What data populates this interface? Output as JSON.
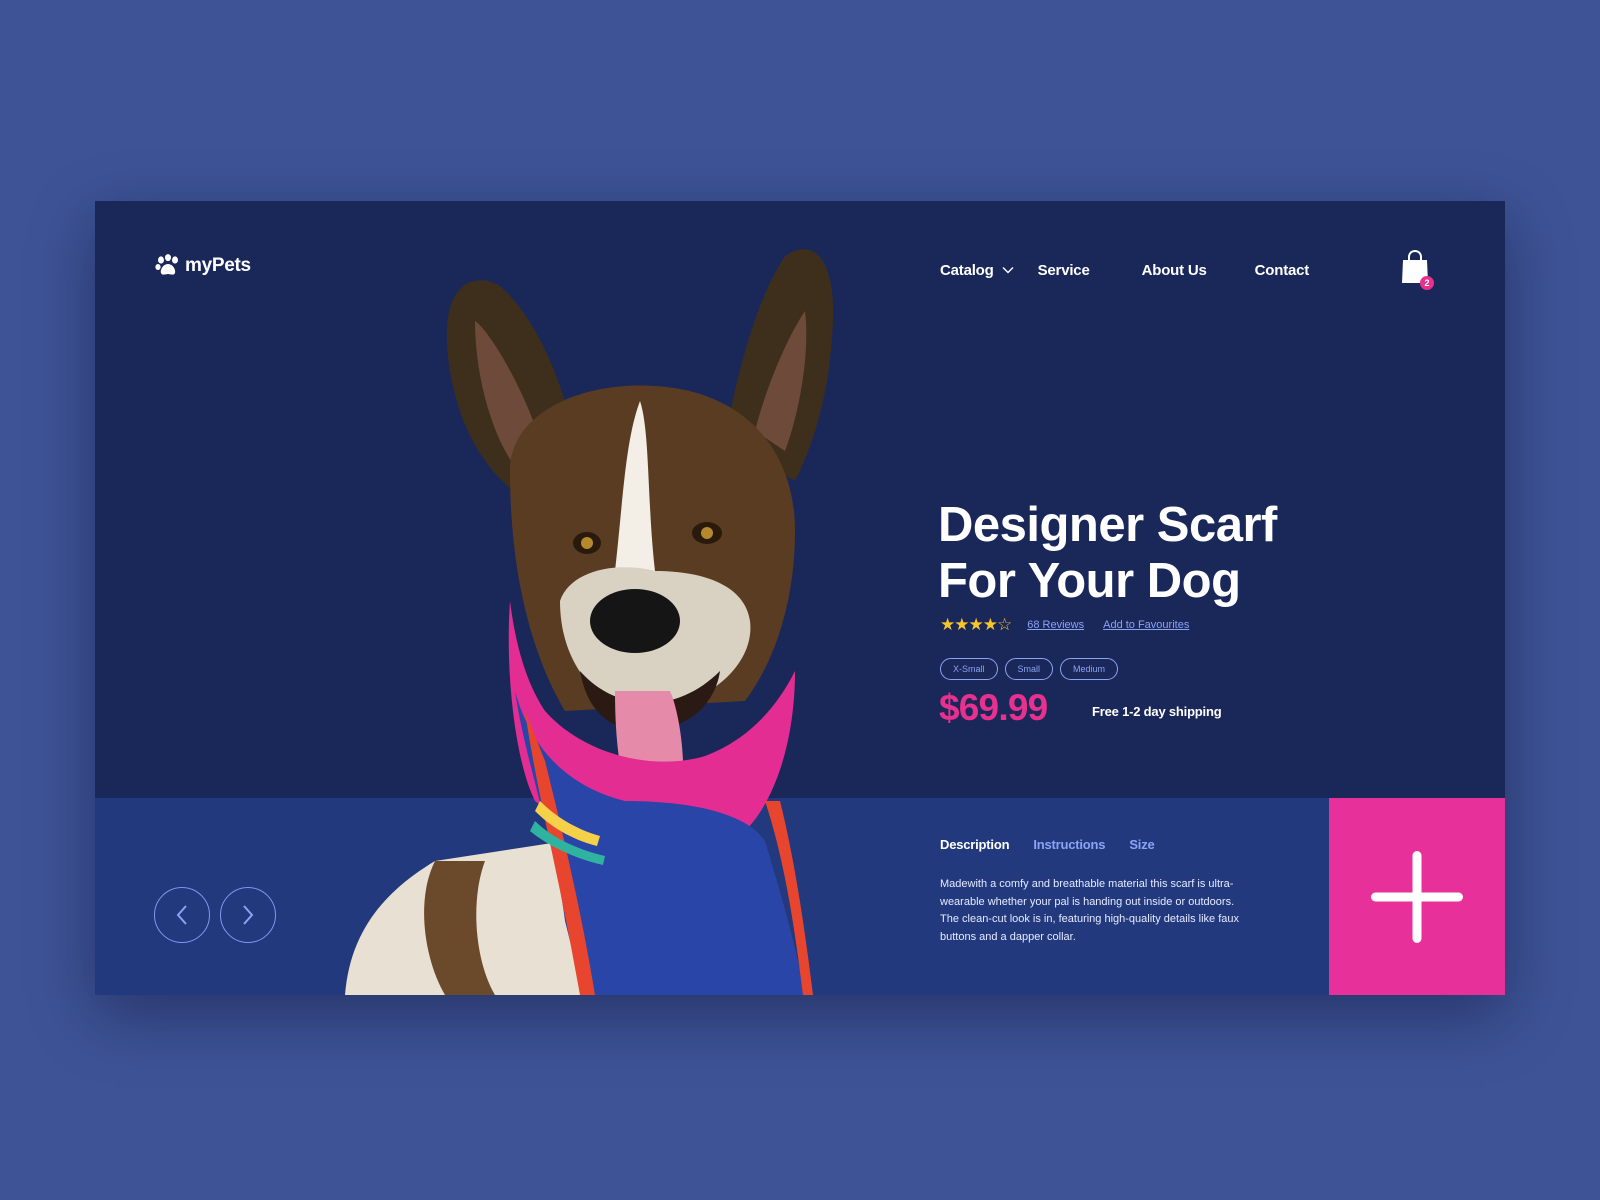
{
  "brand": {
    "name": "myPets",
    "icon": "paw-icon"
  },
  "nav": {
    "items": [
      {
        "label": "Catalog",
        "has_dropdown": true
      },
      {
        "label": "Service"
      },
      {
        "label": "About Us"
      },
      {
        "label": "Contact"
      }
    ],
    "cart": {
      "icon": "shopping-bag-icon",
      "count": "2"
    }
  },
  "product": {
    "title_line1": "Designer Scarf",
    "title_line2": "For Your Dog",
    "rating": {
      "value": 4,
      "max": 5
    },
    "reviews_label": "68 Reviews",
    "favourites_label": "Add to Favourites",
    "sizes": [
      "X-Small",
      "Small",
      "Medium"
    ],
    "price": "$69.99",
    "shipping": "Free 1-2 day shipping"
  },
  "tabs": [
    {
      "label": "Description",
      "active": true
    },
    {
      "label": "Instructions",
      "active": false
    },
    {
      "label": "Size",
      "active": false
    }
  ],
  "description": "Madewith a comfy and breathable material this scarf is ultra-wearable whether your pal is handing out inside or outdoors. The clean-cut look is in, featuring high-quality details like faux buttons and a dapper collar.",
  "controls": {
    "prev_icon": "chevron-left-icon",
    "next_icon": "chevron-right-icon",
    "add_icon": "plus-icon"
  },
  "colors": {
    "page_bg": "#3e5396",
    "card_bg": "#1a2759",
    "band_bg": "#22397e",
    "accent_pink": "#e8308e",
    "link_blue": "#8ba3f5",
    "star_yellow": "#f6c62a"
  }
}
